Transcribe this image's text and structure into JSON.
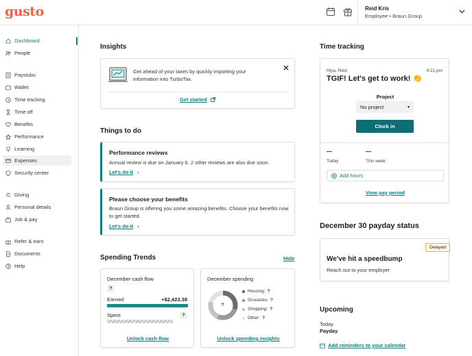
{
  "brand": {
    "logo": "gusto",
    "accent": "#0a8080",
    "logo_color": "#f45d48"
  },
  "header": {
    "calendar_icon": "calendar-icon",
    "gift_icon": "gift-icon",
    "user_name": "Reid Kris",
    "user_role": "Employee • Braun Group"
  },
  "sidebar": {
    "items": [
      {
        "label": "Dashboard",
        "icon": "home-icon"
      },
      {
        "label": "People",
        "icon": "people-icon"
      },
      {
        "label": "Paystubs",
        "icon": "paystub-icon"
      },
      {
        "label": "Wallet",
        "icon": "wallet-icon"
      },
      {
        "label": "Time tracking",
        "icon": "clock-icon"
      },
      {
        "label": "Time off",
        "icon": "hourglass-icon"
      },
      {
        "label": "Benefits",
        "icon": "heart-icon"
      },
      {
        "label": "Performance",
        "icon": "star-icon"
      },
      {
        "label": "Learning",
        "icon": "lightbulb-icon"
      },
      {
        "label": "Expenses",
        "icon": "card-icon"
      },
      {
        "label": "Security center",
        "icon": "shield-icon"
      },
      {
        "label": "Giving",
        "icon": "giving-icon"
      },
      {
        "label": "Personal details",
        "icon": "person-icon"
      },
      {
        "label": "Job & pay",
        "icon": "briefcase-icon"
      },
      {
        "label": "Refer & earn",
        "icon": "gift-icon"
      },
      {
        "label": "Documents",
        "icon": "document-icon"
      },
      {
        "label": "Help",
        "icon": "help-icon"
      }
    ]
  },
  "insights": {
    "title": "Insights",
    "text": "Get ahead of your taxes by quickly importing your information into TurboTax.",
    "cta": "Get started"
  },
  "todo": {
    "title": "Things to do",
    "items": [
      {
        "title": "Performance reviews",
        "desc": "Annual review is due on January 6. 2 other reviews are also due soon.",
        "cta": "Let's do it"
      },
      {
        "title": "Please choose your benefits",
        "desc": "Braun Group is offering you some amazing benefits. Choose your benefits now to get started.",
        "cta": "Let's do it"
      }
    ]
  },
  "spending": {
    "title": "Spending Trends",
    "hide": "Hide",
    "cashflow": {
      "title": "December cash flow",
      "unknown": "?",
      "earned_label": "Earned",
      "earned_value": "+$2,423.38",
      "spent_label": "Spent",
      "spent_value": "?",
      "cta": "Unlock cash flow"
    },
    "dec_spending": {
      "title": "December spending",
      "center": "?",
      "categories": [
        {
          "label": "Housing:",
          "value": "?",
          "color": "#6b6b6b"
        },
        {
          "label": "Groceries:",
          "value": "?",
          "color": "#9a9a9a"
        },
        {
          "label": "Shopping:",
          "value": "?",
          "color": "#c2c2c2"
        },
        {
          "label": "Other:",
          "value": "?",
          "color": "#e2e2e2"
        }
      ],
      "cta": "Unlock spending insights"
    }
  },
  "time_tracking": {
    "title": "Time tracking",
    "greeting": "Hiya, Reid",
    "time": "4:21 pm",
    "headline": "TGIF! Let's get to work! 👏",
    "project_label": "Project",
    "project_value": "No project",
    "clock_in": "Clock in",
    "today_value": "—",
    "today_label": "Today",
    "week_value": "—",
    "week_label": "This week",
    "add_hours": "Add hours",
    "view_pay": "View pay period"
  },
  "payday": {
    "title": "December 30 payday status",
    "badge": "Delayed",
    "headline": "We've hit a speedbump",
    "sub": "Reach out to your employer"
  },
  "upcoming": {
    "title": "Upcoming",
    "when": "Today",
    "what": "Payday",
    "cta": "Add reminders to your calendar"
  }
}
